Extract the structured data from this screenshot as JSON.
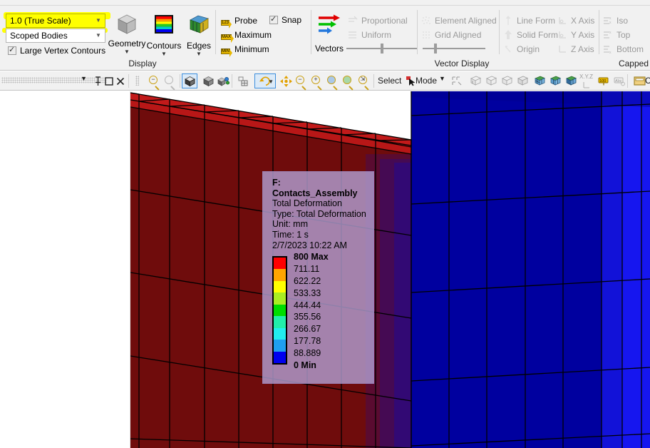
{
  "ribbon": {
    "scale_combo": {
      "value": "1.0 (True Scale)",
      "highlighted": true
    },
    "scope_combo": {
      "value": "Scoped Bodies"
    },
    "large_vertex_contours": {
      "label": "Large Vertex Contours",
      "checked": true
    },
    "display_group": {
      "label": "Display",
      "buttons": [
        {
          "label": "Geometry",
          "icon": "gray-cube-icon"
        },
        {
          "label": "Contours",
          "icon": "contour-bands-icon"
        },
        {
          "label": "Edges",
          "icon": "edges-cube-icon"
        }
      ]
    },
    "probe_items": [
      {
        "label": "Probe",
        "icon": "probe-123-tag-icon",
        "tag": "123"
      },
      {
        "label": "Maximum",
        "icon": "maximum-tag-icon",
        "tag": "MAX"
      },
      {
        "label": "Minimum",
        "icon": "minimum-tag-icon",
        "tag": "MIN"
      }
    ],
    "snap": {
      "label": "Snap",
      "checked": true
    },
    "vectors": {
      "label": "Vectors",
      "icon": "rgb-arrows-icon"
    },
    "vector_mode": [
      {
        "label": "Proportional",
        "icon": "proportional-icon",
        "enabled": false
      },
      {
        "label": "Uniform",
        "icon": "uniform-icon",
        "enabled": false
      }
    ],
    "vector_display": {
      "label": "Vector Display",
      "items": [
        {
          "label": "Element Aligned",
          "icon": "element-aligned-icon",
          "enabled": false
        },
        {
          "label": "Grid Aligned",
          "icon": "grid-aligned-icon",
          "enabled": false
        }
      ]
    },
    "form_items": [
      {
        "label": "Line Form",
        "icon": "line-form-icon",
        "enabled": false
      },
      {
        "label": "Solid Form",
        "icon": "solid-form-icon",
        "enabled": false
      },
      {
        "label": "Origin",
        "icon": "origin-icon",
        "enabled": false
      }
    ],
    "axis_items": [
      {
        "label": "X Axis",
        "icon": "x-axis-icon",
        "enabled": false
      },
      {
        "label": "Y Axis",
        "icon": "y-axis-icon",
        "enabled": false
      },
      {
        "label": "Z Axis",
        "icon": "z-axis-icon",
        "enabled": false
      }
    ],
    "capped_group": {
      "label": "Capped",
      "items": [
        {
          "label": "Iso",
          "icon": "iso-view-icon",
          "enabled": false
        },
        {
          "label": "Top",
          "icon": "top-view-icon",
          "enabled": false
        },
        {
          "label": "Bottom",
          "icon": "bottom-view-icon",
          "enabled": false
        }
      ]
    }
  },
  "toolbar": {
    "pin_icon": "pin-icon",
    "restore_icon": "restore-window-icon",
    "close_icon": "close-icon",
    "dropdown_icon": "chevron-down-icon",
    "zoom_out_icon": "zoom-out-icon",
    "zoom_in_gray_icon": "zoom-in-disabled-icon",
    "show_body_icon": "show-body-icon",
    "wireframe_icon": "wireframe-cube-icon",
    "shaded_icon": "shaded-exploded-icon",
    "mesh_icon": "mesh-grid-icon",
    "rotate_icon": "rotate-icon",
    "pan_icon": "pan-icon",
    "zoom_tools": [
      "zoom-tool-1",
      "zoom-tool-2",
      "zoom-tool-3",
      "zoom-tool-4",
      "zoom-tool-5"
    ],
    "select_label": "Select",
    "mode_label": "Mode",
    "cursor_icon": "select-cursor-icon",
    "section_icons": [
      "probe-tool-icon",
      "body-face-1",
      "body-face-2",
      "body-face-3",
      "body-face-4",
      "mesh-body-1",
      "mesh-body-2",
      "mesh-body-3"
    ],
    "xyz_label": "X.Y.Z",
    "ruler_icon": "ruler-100-icon",
    "annotation_icon": "annotation-abc-icon",
    "clipboard_label": "Cl",
    "clipboard_icon": "clipboard-folder-icon"
  },
  "legend": {
    "title": "F: Contacts_Assembly",
    "result_name": "Total Deformation",
    "type": "Type: Total Deformation",
    "unit": "Unit: mm",
    "time": "Time: 1 s",
    "timestamp": "2/7/2023 10:22 AM",
    "max_label": "800 Max",
    "min_label": "0 Min",
    "values": [
      "711.11",
      "622.22",
      "533.33",
      "444.44",
      "355.56",
      "266.67",
      "177.78",
      "88.889"
    ],
    "band_colors": [
      "#ff0000",
      "#ffa500",
      "#ffff00",
      "#aaee22",
      "#00dd00",
      "#22eeaa",
      "#22eeee",
      "#1f9ff0",
      "#0000ee"
    ]
  },
  "colors": {
    "ribbon_bg": "#f1f1f1",
    "viewport_bg": "#ffffff",
    "body_red": "#7a0d0d",
    "body_red_top": "#b81717",
    "body_blue": "#0000b0",
    "body_blue_light": "#1414ee",
    "legend_panel": "#b2a0d4",
    "highlight_yellow": "#ffff00",
    "accent_blue": "#3c8ede"
  }
}
